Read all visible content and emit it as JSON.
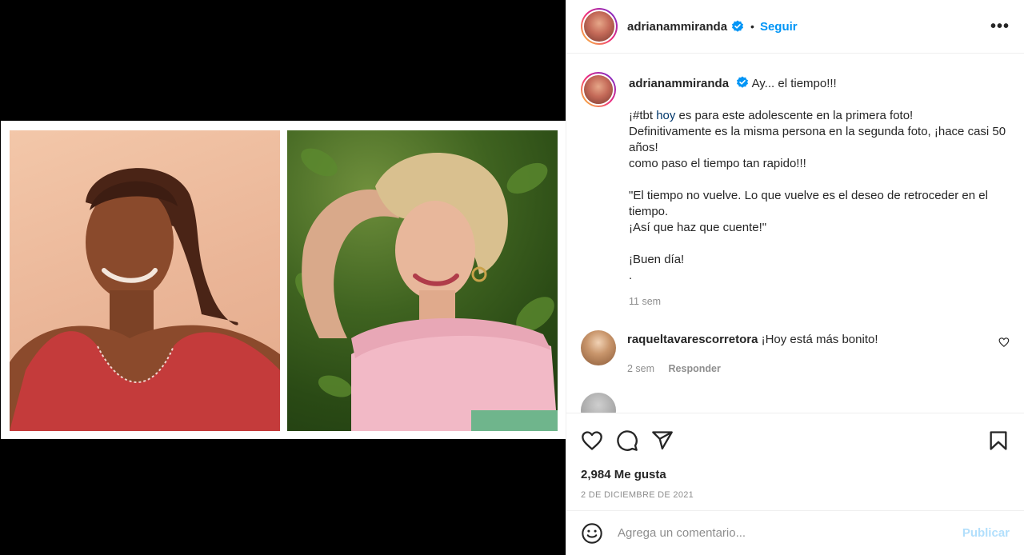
{
  "post": {
    "username": "adrianammiranda",
    "follow_label": "Seguir",
    "more_label": "•••",
    "dot": "•"
  },
  "caption": {
    "username": "adrianammiranda",
    "line1": "Ay... el tiempo!!!",
    "line2_prefix": "¡#tbt ",
    "line2_tag": "hoy",
    "line2_suffix": " es para este adolescente en la primera foto!",
    "line3": "Definitivamente es la misma persona en la segunda foto, ¡hace casi 50 años!",
    "line4": "como paso el tiempo tan rapido!!!",
    "line5": "\"El tiempo no vuelve. Lo que vuelve es el deseo de retroceder en el tiempo.",
    "line6": "¡Así que haz que cuente!\"",
    "line7": "¡Buen día!",
    "line8": ".",
    "time": "11 sem"
  },
  "comments": [
    {
      "username": "raqueltavarescorretora",
      "text": "¡Hoy está más bonito!",
      "time": "2 sem",
      "reply_label": "Responder"
    }
  ],
  "stats": {
    "likes": "2,984 Me gusta",
    "date": "2 DE DICIEMBRE DE 2021"
  },
  "add_comment": {
    "placeholder": "Agrega un comentario...",
    "publish_label": "Publicar"
  },
  "colors": {
    "accent": "#0095f6",
    "publish_disabled": "#b2dffc",
    "meta": "#8e8e8e"
  }
}
